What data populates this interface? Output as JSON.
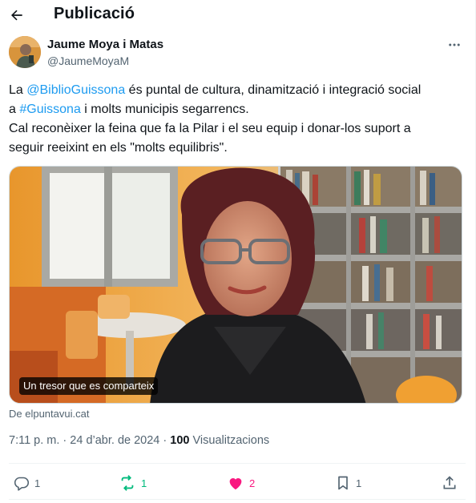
{
  "header": {
    "title": "Publicació",
    "back_icon": "arrow-left-icon"
  },
  "author": {
    "name": "Jaume Moya i Matas",
    "handle": "@JaumeMoyaM",
    "more_icon": "more-horizontal-icon"
  },
  "tweet": {
    "line1_pre": "La ",
    "line1_mention": "@BiblioGuissona",
    "line1_post": " és puntal de cultura, dinamització i integració social",
    "line2_pre": "a ",
    "line2_hashtag": "#Guissona",
    "line2_post": " i molts municipis segarrencs.",
    "line3": "Cal reconèixer la feina que fa la Pilar i el seu equip i donar-los suport a",
    "line4": "seguir reeixint en els \"molts equilibris\"."
  },
  "card": {
    "caption": "Un tresor que es comparteix",
    "source": "De elpuntavui.cat"
  },
  "meta": {
    "time": "7:11 p. m.",
    "separator": " · ",
    "date": "24 d’abr. de 2024",
    "separator2": " · ",
    "views_count": "100",
    "views_label": " Visualitzacions"
  },
  "actions": {
    "replies": "1",
    "retweets": "1",
    "likes": "2",
    "bookmarks": "1"
  },
  "colors": {
    "accent": "#1d9bf0",
    "retweet": "#00ba7c",
    "like": "#f91880",
    "muted": "#536471"
  }
}
